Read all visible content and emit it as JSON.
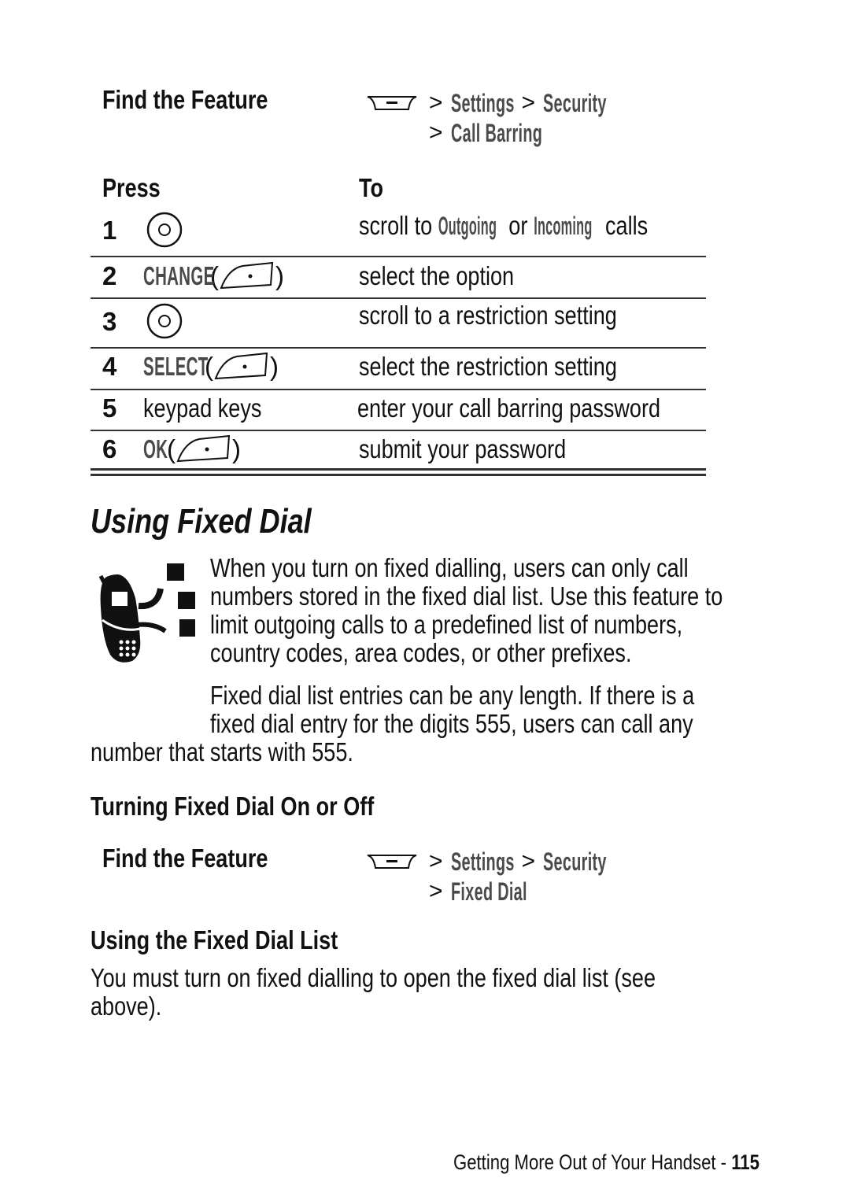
{
  "call_barring": {
    "find_feature_label": "Find the Feature",
    "menu_icon": "menu-key-icon",
    "path_line1": [
      ">",
      "Settings",
      ">",
      "Security"
    ],
    "path_line2": [
      ">",
      "Call Barring"
    ],
    "table": {
      "header_press": "Press",
      "header_to": "To",
      "rows": [
        {
          "num": "1",
          "press_icon": "nav-key-icon",
          "press_label": "",
          "to": [
            "scroll to ",
            "Outgoing",
            " or ",
            "Incoming",
            " calls"
          ]
        },
        {
          "num": "2",
          "press_label": "CHANGE",
          "press_icon": "right-soft-key-icon",
          "to": [
            "select the option"
          ]
        },
        {
          "num": "3",
          "press_icon": "nav-key-icon",
          "press_label": "",
          "to": [
            "scroll to a restriction setting"
          ]
        },
        {
          "num": "4",
          "press_label": "SELECT",
          "press_icon": "right-soft-key-icon",
          "to": [
            "select the restriction setting"
          ]
        },
        {
          "num": "5",
          "press_label": "keypad keys",
          "press_icon": "",
          "to": [
            "enter your call barring password"
          ]
        },
        {
          "num": "6",
          "press_label": "OK",
          "press_icon": "right-soft-key-icon",
          "to": [
            "submit your password"
          ]
        }
      ]
    }
  },
  "fixed_dial": {
    "title": "Using Fixed Dial",
    "feature_icon": "network-feature-icon",
    "para1": [
      "When you turn on fixed dialling, users can only call",
      "numbers stored in the fixed dial list. Use this feature to",
      "limit outgoing calls to a predefined list of numbers,",
      "country codes, area codes, or other prefixes."
    ],
    "para2": [
      "Fixed dial list entries can be any length. If there is a",
      "fixed dial entry for the digits 555, users can call any",
      "number that starts with 555."
    ],
    "turning": {
      "title": "Turning Fixed Dial On or Off",
      "find_feature_label": "Find the Feature",
      "path_line1": [
        ">",
        "Settings",
        ">",
        "Security"
      ],
      "path_line2": [
        ">",
        "Fixed Dial"
      ]
    },
    "list": {
      "title": "Using the Fixed Dial List",
      "text": [
        "You must turn on fixed dialling to open the fixed dial list (see",
        "above)."
      ]
    }
  },
  "footer": {
    "chapter": "Getting More Out of Your Handset - ",
    "page_number": "115"
  }
}
